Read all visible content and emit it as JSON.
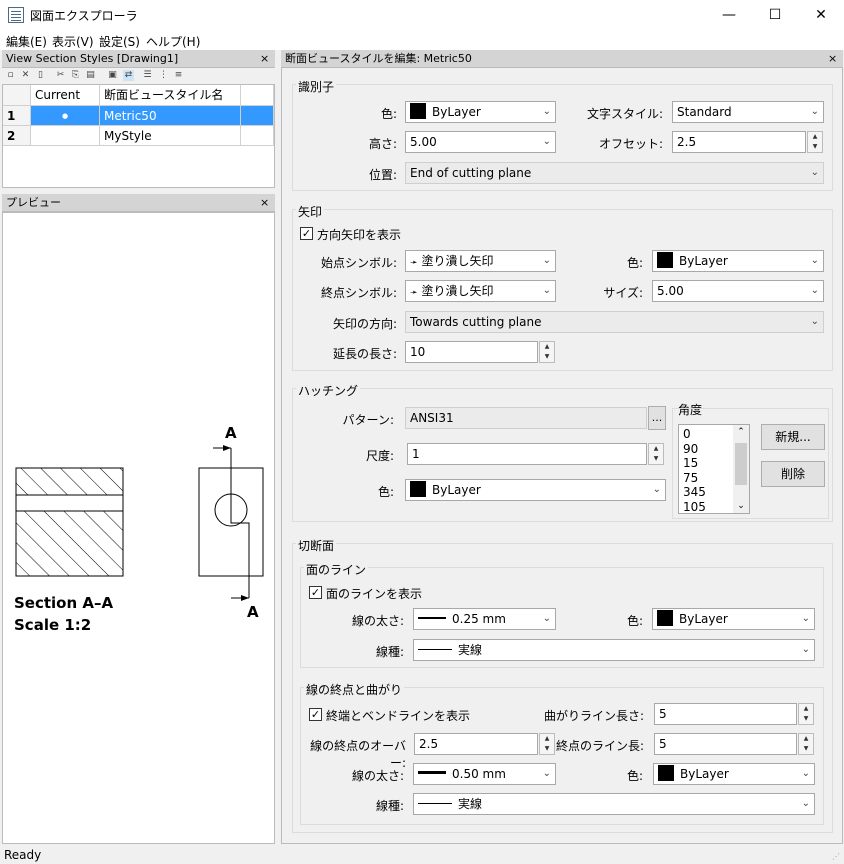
{
  "window": {
    "title": "図面エクスプローラ",
    "minimize": "—",
    "maximize": "☐",
    "close": "✕"
  },
  "menu": [
    "編集(E)",
    "表示(V)",
    "設定(S)",
    "ヘルプ(H)"
  ],
  "styles_panel": {
    "title": "View Section Styles [Drawing1]",
    "close": "×",
    "columns": [
      "Current",
      "断面ビュースタイル名"
    ],
    "rows": [
      {
        "num": "1",
        "current": "●",
        "name": "Metric50"
      },
      {
        "num": "2",
        "current": "",
        "name": "MyStyle"
      }
    ]
  },
  "preview": {
    "title": "プレビュー",
    "close": "×",
    "marker_top": "A",
    "marker_bottom": "A",
    "section_label": "Section A–A",
    "scale_label": "Scale 1:2"
  },
  "editor": {
    "title": "断面ビュースタイルを編集: Metric50",
    "close": "×",
    "identifier": {
      "group": "識別子",
      "color_label": "色:",
      "color_value": "ByLayer",
      "textstyle_label": "文字スタイル:",
      "textstyle_value": "Standard",
      "height_label": "高さ:",
      "height_value": "5.00",
      "offset_label": "オフセット:",
      "offset_value": "2.5",
      "position_label": "位置:",
      "position_value": "End of cutting plane"
    },
    "arrow": {
      "group": "矢印",
      "show_label": "方向矢印を表示",
      "show_checked": true,
      "start_label": "始点シンボル:",
      "start_value": "塗り潰し矢印",
      "color_label": "色:",
      "color_value": "ByLayer",
      "end_label": "終点シンボル:",
      "end_value": "塗り潰し矢印",
      "size_label": "サイズ:",
      "size_value": "5.00",
      "direction_label": "矢印の方向:",
      "direction_value": "Towards cutting plane",
      "ext_label": "延長の長さ:",
      "ext_value": "10"
    },
    "hatch": {
      "group": "ハッチング",
      "pattern_label": "パターン:",
      "pattern_value": "ANSI31",
      "pattern_btn": "...",
      "scale_label": "尺度:",
      "scale_value": "1",
      "color_label": "色:",
      "color_value": "ByLayer",
      "angle_label": "角度",
      "angles": [
        "0",
        "90",
        "15",
        "75",
        "345",
        "105"
      ],
      "new_btn": "新規...",
      "delete_btn": "削除"
    },
    "cutting": {
      "group": "切断面",
      "plane": {
        "group": "面のライン",
        "show_label": "面のラインを表示",
        "lw_label": "線の太さ:",
        "lw_value": "0.25 mm",
        "color_label": "色:",
        "color_value": "ByLayer",
        "lt_label": "線種:",
        "lt_value": "実線"
      },
      "ends": {
        "group": "線の終点と曲がり",
        "show_label": "終端とベンドラインを表示",
        "bend_label": "曲がりライン長さ:",
        "bend_value": "5",
        "over_label": "線の終点のオーバー:",
        "over_value": "2.5",
        "endlen_label": "終点のライン長:",
        "endlen_value": "5",
        "lw_label": "線の太さ:",
        "lw_value": "0.50 mm",
        "color_label": "色:",
        "color_value": "ByLayer",
        "lt_label": "線種:",
        "lt_value": "実線"
      }
    }
  },
  "status": "Ready"
}
